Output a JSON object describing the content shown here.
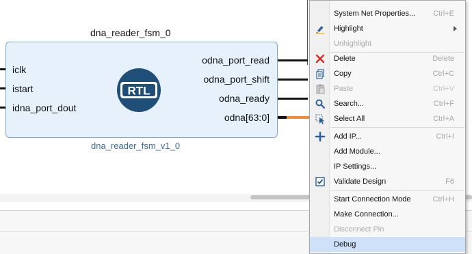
{
  "block": {
    "instance_name": "dna_reader_fsm_0",
    "module_name": "dna_reader_fsm_v1_0",
    "logo_text": "RTL",
    "inputs": [
      "iclk",
      "istart",
      "idna_port_dout"
    ],
    "outputs": [
      "odna_port_read",
      "odna_port_shift",
      "odna_ready",
      "odna[63:0]"
    ]
  },
  "context_menu": {
    "items": [
      {
        "label": "System Net Properties...",
        "shortcut": "Ctrl+E",
        "icon": "none",
        "disabled": false
      },
      {
        "label": "Highlight",
        "shortcut": "",
        "icon": "highlight-pen-icon",
        "disabled": false,
        "submenu": true
      },
      {
        "label": "Unhighlight",
        "shortcut": "",
        "icon": "none",
        "disabled": true
      },
      {
        "label": "Delete",
        "shortcut": "Delete",
        "icon": "red-x-icon",
        "disabled": false
      },
      {
        "label": "Copy",
        "shortcut": "Ctrl+C",
        "icon": "copy-icon",
        "disabled": false
      },
      {
        "label": "Paste",
        "shortcut": "Ctrl+V",
        "icon": "paste-icon",
        "disabled": true
      },
      {
        "label": "Search...",
        "shortcut": "Ctrl+F",
        "icon": "magnifier-icon",
        "disabled": false
      },
      {
        "label": "Select All",
        "shortcut": "Ctrl+A",
        "icon": "select-all-icon",
        "disabled": false
      },
      {
        "label": "Add IP...",
        "shortcut": "Ctrl+I",
        "icon": "plus-icon",
        "disabled": false
      },
      {
        "label": "Add Module...",
        "shortcut": "",
        "icon": "none",
        "disabled": false
      },
      {
        "label": "IP Settings...",
        "shortcut": "",
        "icon": "none",
        "disabled": false
      },
      {
        "label": "Validate Design",
        "shortcut": "F6",
        "icon": "checkbox-icon",
        "disabled": false
      },
      {
        "label": "Start Connection Mode",
        "shortcut": "Ctrl+H",
        "icon": "none",
        "disabled": false
      },
      {
        "label": "Make Connection...",
        "shortcut": "",
        "icon": "none",
        "disabled": false
      },
      {
        "label": "Disconnect Pin",
        "shortcut": "",
        "icon": "none",
        "disabled": true
      },
      {
        "label": "Debug",
        "shortcut": "",
        "icon": "none",
        "disabled": false,
        "selected": true
      }
    ]
  },
  "colors": {
    "block_fill": "#e6f1fb",
    "block_border": "#7ea6c9",
    "module_name": "#3a6e9e",
    "bus_orange": "#f28c3c",
    "menu_selected": "#cfe1f8",
    "logo_blue": "#1f4e79"
  }
}
